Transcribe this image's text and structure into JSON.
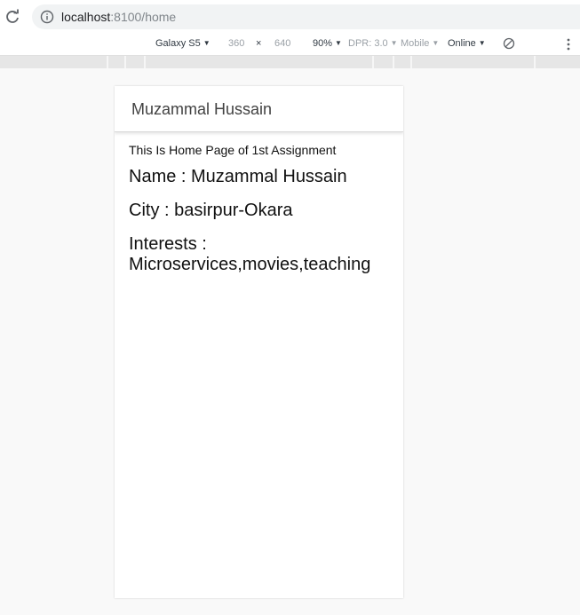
{
  "browser": {
    "url_host": "localhost",
    "url_rest": ":8100/home"
  },
  "device_toolbar": {
    "device": "Galaxy S5",
    "width": "360",
    "times": "×",
    "height": "640",
    "zoom": "90%",
    "dpr": "DPR: 3.0",
    "mode": "Mobile",
    "network": "Online"
  },
  "app": {
    "header_title": "Muzammal Hussain",
    "intro": "This Is Home Page of 1st Assignment",
    "name_line": "Name : Muzammal Hussain",
    "city_line": "City : basirpur-Okara",
    "interests_label": "Interests :",
    "interests_value": "Microservices,movies,teaching"
  },
  "icons": {
    "reload": "reload-icon",
    "info": "info-icon",
    "rotate": "rotate-icon",
    "menu": "kebab-menu-icon"
  }
}
